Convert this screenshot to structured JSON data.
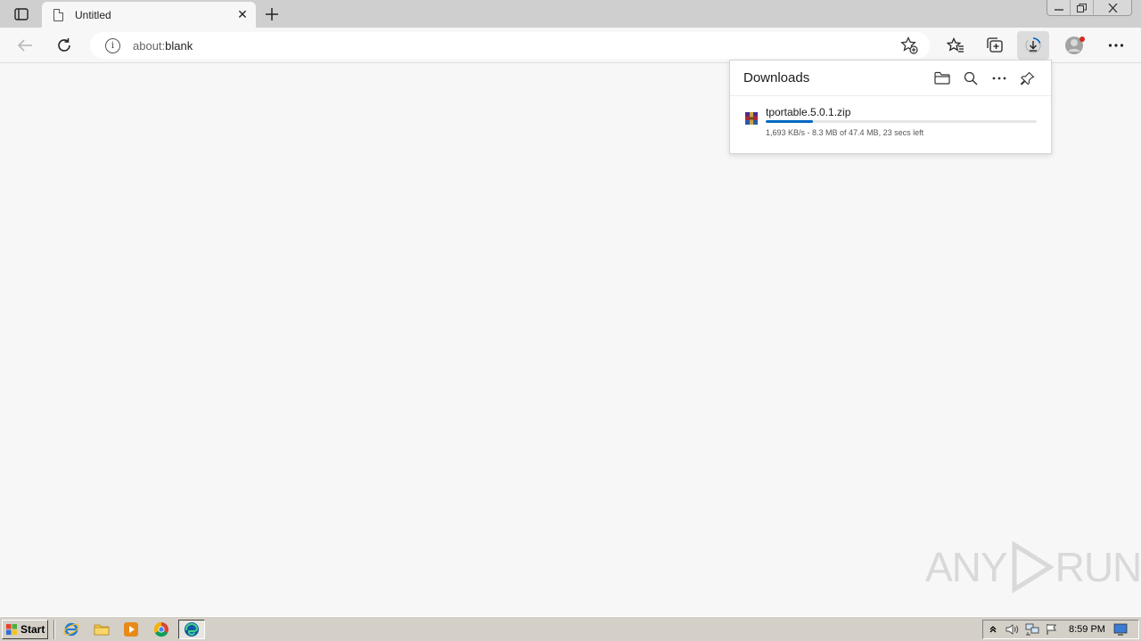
{
  "browser": {
    "tab": {
      "title": "Untitled",
      "close_glyph": "✕"
    },
    "new_tab_glyph": "+",
    "address_bar": {
      "url_prefix": "about:",
      "url_rest": "blank"
    }
  },
  "downloads": {
    "title": "Downloads",
    "items": [
      {
        "file_name": "tportable.5.0.1.zip",
        "status": "1,693 KB/s - 8.3 MB of 47.4 MB, 23 secs left",
        "progress_fraction": 0.175
      }
    ]
  },
  "watermark": {
    "left": "ANY",
    "right": "RUN"
  },
  "taskbar": {
    "start_label": "Start",
    "clock": "8:59 PM"
  },
  "colors": {
    "accent": "#0067c0",
    "tab_strip": "#cfcfcf",
    "page_bg": "#f7f7f7",
    "taskbar": "#d4d0c8"
  }
}
